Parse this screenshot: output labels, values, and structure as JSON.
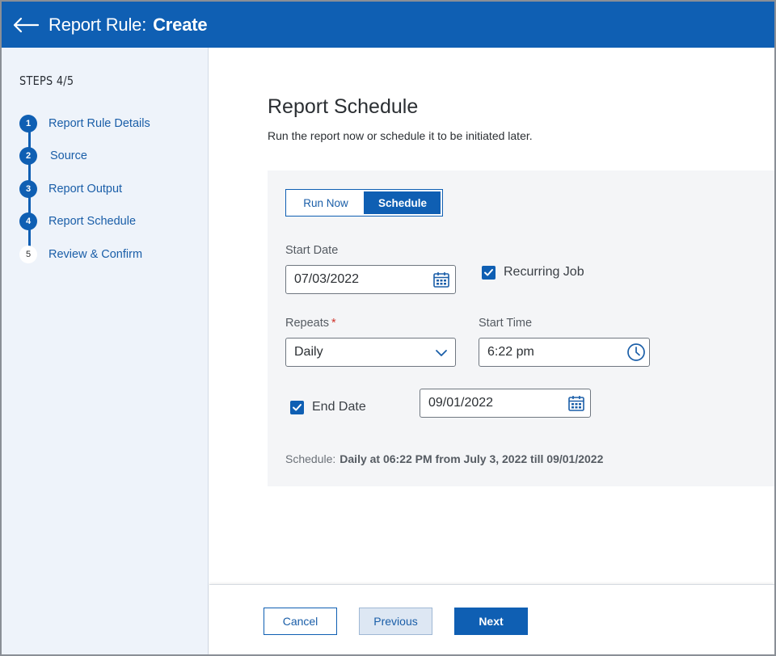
{
  "header": {
    "title_prefix": "Report Rule:",
    "title_action": "Create",
    "back_icon": "arrow-left-icon"
  },
  "sidebar": {
    "steps_title": "STEPS 4/5",
    "steps": [
      {
        "number": "1",
        "label": "Report Rule Details",
        "state": "completed"
      },
      {
        "number": "2",
        "label": "Source",
        "state": "completed"
      },
      {
        "number": "3",
        "label": "Report Output",
        "state": "completed"
      },
      {
        "number": "4",
        "label": "Report Schedule",
        "state": "current"
      },
      {
        "number": "5",
        "label": "Review & Confirm",
        "state": "pending"
      }
    ]
  },
  "main": {
    "title": "Report Schedule",
    "subtitle": "Run the report now or schedule it to be initiated later.",
    "toggle": {
      "run_now_label": "Run Now",
      "schedule_label": "Schedule",
      "selected": "Schedule"
    },
    "start_date": {
      "label": "Start Date",
      "value": "07/03/2022",
      "icon": "calendar-icon"
    },
    "recurring_job": {
      "label": "Recurring Job",
      "checked": true
    },
    "repeats": {
      "label": "Repeats",
      "required_marker": "*",
      "value": "Daily",
      "icon": "chevron-down-icon"
    },
    "start_time": {
      "label": "Start Time",
      "value": "6:22 pm",
      "icon": "clock-icon"
    },
    "end_date": {
      "label": "End Date",
      "checked": true,
      "value": "09/01/2022",
      "icon": "calendar-icon"
    },
    "schedule_summary": {
      "label": "Schedule:",
      "value": "Daily at 06:22 PM from July 3, 2022 till 09/01/2022"
    }
  },
  "footer": {
    "cancel_label": "Cancel",
    "previous_label": "Previous",
    "next_label": "Next"
  },
  "colors": {
    "brand_blue": "#0f5fb3",
    "link_blue": "#1a5ea8",
    "sidebar_bg": "#eef3fa",
    "panel_bg": "#f4f5f7",
    "required_red": "#d0342c"
  }
}
